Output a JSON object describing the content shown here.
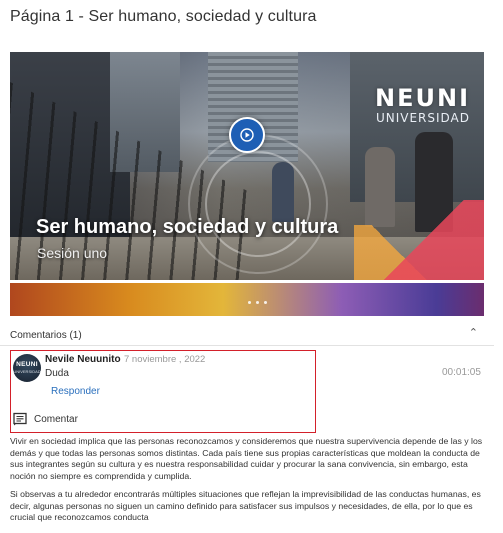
{
  "page": {
    "title": "Página 1 - Ser humano, sociedad y cultura"
  },
  "video": {
    "title": "Ser humano, sociedad y cultura",
    "subtitle": "Sesión uno",
    "brand_name": "NEUNI",
    "brand_tagline": "UNIVERSIDAD",
    "play_icon": "play-icon",
    "accent_color": "#1e5fb5"
  },
  "comments": {
    "header": "Comentarios (1)",
    "collapse_icon": "chevron-up-icon",
    "items": [
      {
        "author": "Nevile Neuunito",
        "date": "7 noviembre , 2022",
        "text": "Duda",
        "reply_label": "Responder",
        "timestamp": "00:01:05",
        "avatar_text": "NEUNI",
        "avatar_subtext": "UNIVERSIDAD"
      }
    ],
    "comment_action_label": "Comentar",
    "comment_action_icon": "comment-icon",
    "highlight_color": "#d3202a"
  },
  "body": {
    "paragraph_1": "Vivir en sociedad implica que las personas reconozcamos y consideremos que nuestra supervivencia depende de las y los demás y que todas las personas somos distintas. Cada país tiene sus propias características que moldean la conducta de sus integrantes según su cultura y es nuestra responsabilidad cuidar y procurar la sana convivencia, sin embargo, esta noción no siempre es comprendida y cumplida.",
    "paragraph_2": "Si observas a tu alrededor encontrarás múltiples situaciones que reflejan la imprevisibilidad de las conductas humanas, es decir, algunas personas no siguen un camino definido para satisfacer sus impulsos y necesidades, de ella, por lo que es crucial que reconozcamos conducta"
  }
}
